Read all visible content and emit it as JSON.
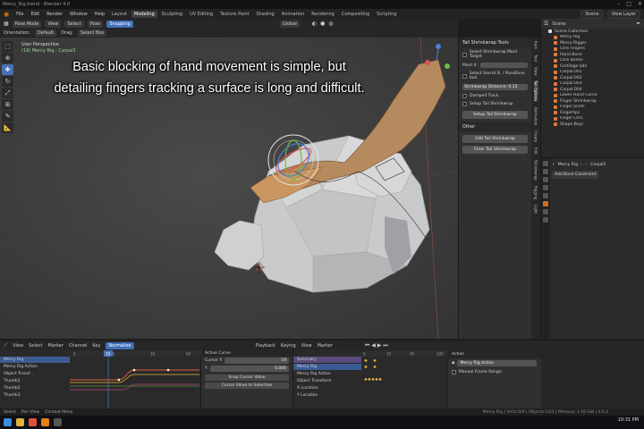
{
  "window": {
    "title": "Mercy_Rig.blend - Blender 4.0"
  },
  "menubar": {
    "items": [
      "File",
      "Edit",
      "Render",
      "Window",
      "Help"
    ]
  },
  "workspaces": [
    "Layout",
    "Modeling",
    "Sculpting",
    "UV Editing",
    "Texture Paint",
    "Shading",
    "Animation",
    "Rendering",
    "Compositing",
    "Scripting"
  ],
  "active_workspace": "Animation",
  "scene_bar": {
    "scene": "Scene",
    "view_layer": "View Layer"
  },
  "viewport_header": {
    "mode": "Pose Mode",
    "menus": [
      "View",
      "Select",
      "Pose"
    ],
    "snap_label": "Snapping",
    "transform": "Global",
    "orientation_label": "Orientation:",
    "orientation_value": "Default",
    "drag_label": "Drag:",
    "drag_value": "Select Box"
  },
  "viewport_info": {
    "view": "User Perspective",
    "object": "(19) Mercy Rig : Carpal1"
  },
  "caption": {
    "line1": "Basic blocking of hand movement is simple, but",
    "line2": "detailing fingers tracking a surface is long and difficult."
  },
  "npanel": {
    "header": "Tail Shrinkwrap Tools",
    "rows": [
      {
        "label": "Select Shrinkwrap Mant Target",
        "checked": true
      },
      {
        "label": "Mant 4:",
        "field": ""
      },
      {
        "label": "Select Secret B. / PoseBone tool"
      },
      {
        "label": "",
        "field": "Shrinkwrap Distance: 0.15"
      },
      {
        "label": "Damped Track",
        "checked": false
      },
      {
        "label": "Setup Tail Shrinkwrap"
      }
    ],
    "setup_button": "Setup Tail Shrinkwrap",
    "other_header": "Other",
    "edit_button": "Edit Tail Shrinkwrap",
    "clear_button": "Clear Tail Shrinkwrap"
  },
  "vertical_tabs": [
    "Item",
    "Tool",
    "View",
    "Tail Options",
    "Animation",
    "Create",
    "Edit",
    "Shrinkwrap",
    "Rigging",
    "Light"
  ],
  "outliner": {
    "title": "Scene",
    "items": [
      {
        "name": "Scene Collection",
        "type": "coll"
      },
      {
        "name": "Mercy Rig",
        "type": "obj"
      },
      {
        "name": "Mercy Rigger",
        "type": "obj"
      },
      {
        "name": "Ctrls Fingers",
        "type": "obj"
      },
      {
        "name": "Hand Bone",
        "type": "obj"
      },
      {
        "name": "Ctrls Bones",
        "type": "obj"
      },
      {
        "name": "Cartilage bits",
        "type": "obj"
      },
      {
        "name": "Carpal.001",
        "type": "obj"
      },
      {
        "name": "Carpal.002",
        "type": "obj"
      },
      {
        "name": "Carpal.003",
        "type": "obj"
      },
      {
        "name": "Carpal.004",
        "type": "obj"
      },
      {
        "name": "Lower Hand Curve",
        "type": "obj"
      },
      {
        "name": "Finger Shrinkwrap",
        "type": "obj"
      },
      {
        "name": "Finger Joints",
        "type": "obj"
      },
      {
        "name": "Fingertips",
        "type": "obj"
      },
      {
        "name": "Finger Ctrls",
        "type": "obj"
      },
      {
        "name": "Shape Keys",
        "type": "obj"
      }
    ]
  },
  "properties": {
    "object": "Mercy Rig",
    "bone": "Carpal1",
    "add_constraint": "Add Bone Constraint"
  },
  "timeline_header": {
    "editor": "Graph Editor",
    "menus": [
      "View",
      "Select",
      "Marker",
      "Channel",
      "Key"
    ],
    "normalize": "Normalize",
    "playback": "Playback",
    "keying": "Keying",
    "view2": "View",
    "marker2": "Marker"
  },
  "graph": {
    "channels": [
      {
        "name": "Mercy Rig",
        "sel": true
      },
      {
        "name": "Mercy Rig Action",
        "sel": false
      },
      {
        "name": "Object Transf...",
        "sel": false
      },
      {
        "name": "Thumb1",
        "sel": false
      },
      {
        "name": "Thumb2",
        "sel": false
      },
      {
        "name": "Thumb3",
        "sel": false
      }
    ],
    "ruler": [
      "0",
      "16",
      "30",
      "60"
    ],
    "current_frame": "19"
  },
  "fcurve_panel": {
    "active_label": "Active Curve",
    "cursor_x_label": "Cursor X",
    "cursor_x_value": "19",
    "cursor_y_label": "Y",
    "cursor_y_value": "0.000",
    "snap_button": "Snap Cursor Value",
    "cursor_button": "Cursor Value to Selection"
  },
  "dopesheet": {
    "channels": [
      {
        "name": "Summary",
        "kind": "summary"
      },
      {
        "name": "Mercy Rig",
        "kind": "sel"
      },
      {
        "name": "Mercy Rig Action",
        "kind": "norm"
      },
      {
        "name": "Object Transform",
        "kind": "norm"
      },
      {
        "name": "X Location",
        "kind": "norm"
      },
      {
        "name": "Y Location",
        "kind": "norm"
      }
    ],
    "ruler": [
      "0",
      "20",
      "40",
      "100"
    ]
  },
  "action_panel": {
    "header": "Action",
    "action_name": "Mercy Rig Action",
    "manual_range": "Manual Frame Range"
  },
  "statusbar": {
    "items": [
      "Select",
      "Pan View",
      "Context Menu"
    ],
    "right": "Mercy Rig | Verts:0/0 | Objects:1/23 | Memory: 1.16 GiB | 4.0.2"
  },
  "clock": "10:31 PM",
  "colors": {
    "accent": "#4772b3",
    "outliner_obj": "#e07a3a",
    "keyframe": "#e0b23a"
  }
}
